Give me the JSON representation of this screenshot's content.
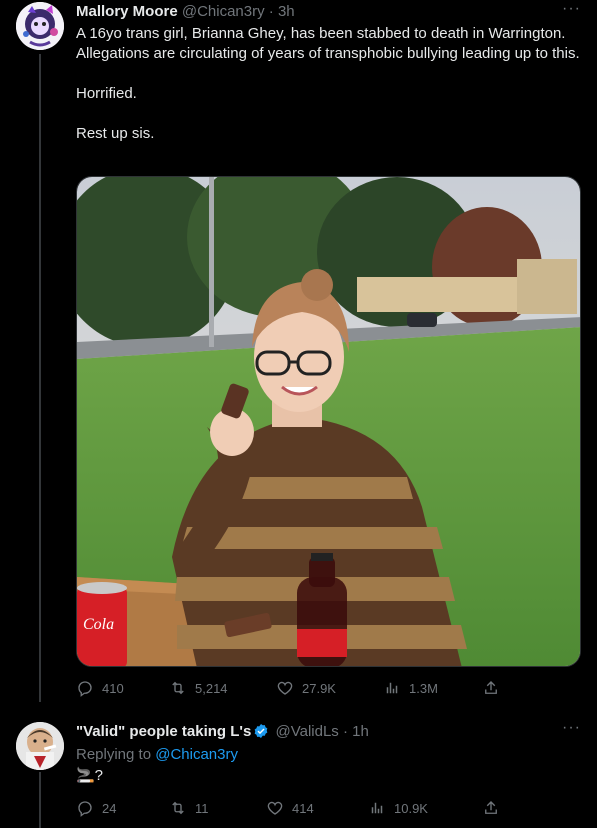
{
  "tweet": {
    "name": "Mallory Moore",
    "handle": "@Chican3ry",
    "time": "· 3h",
    "more": "···",
    "text_1": "A 16yo trans girl, Brianna Ghey, has been stabbed to death in Warrington. Allegations are circulating of years of transphobic bullying leading up to this.",
    "text_2": "Horrified.",
    "text_3": "Rest up sis.",
    "stats": {
      "replies": "410",
      "retweets": "5,214",
      "likes": "27.9K",
      "views": "1.3M"
    }
  },
  "reply": {
    "name": "\"Valid\" people taking L's",
    "handle": "@ValidLs",
    "time": "· 1h",
    "more": "···",
    "replying_label": "Replying to",
    "replying_handle": "@Chican3ry",
    "text": "🚬?",
    "stats": {
      "replies": "24",
      "retweets": "11",
      "likes": "414",
      "views": "10.9K"
    }
  },
  "colors": {
    "background": "#000000",
    "text": "#e7e9ea",
    "muted": "#71767b",
    "link": "#1d9bf0",
    "verified": "#1d9bf0"
  }
}
